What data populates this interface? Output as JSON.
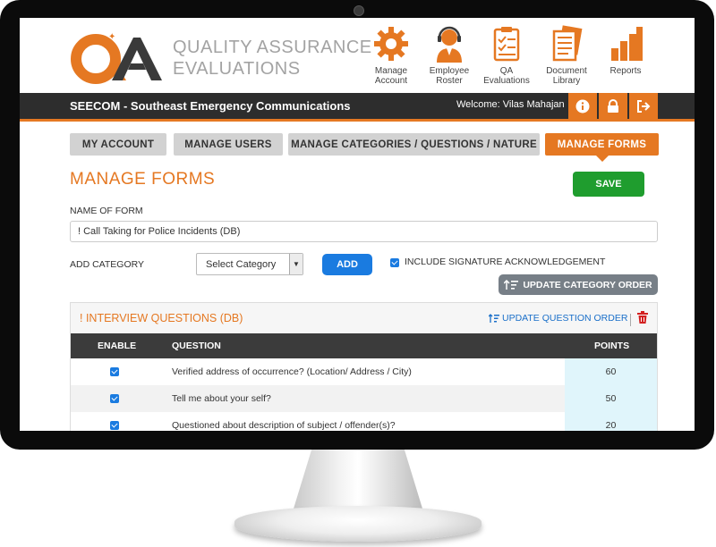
{
  "app": {
    "brand_line1": "QUALITY ASSURANCE",
    "brand_line2": "EVALUATIONS",
    "logo_text": "QA"
  },
  "nav": [
    {
      "label1": "Manage",
      "label2": "Account",
      "icon": "gear-icon"
    },
    {
      "label1": "Employee",
      "label2": "Roster",
      "icon": "headset-user-icon"
    },
    {
      "label1": "QA",
      "label2": "Evaluations",
      "icon": "clipboard-icon"
    },
    {
      "label1": "Document",
      "label2": "Library",
      "icon": "documents-icon"
    },
    {
      "label1": "Reports",
      "label2": "",
      "icon": "bar-chart-icon"
    }
  ],
  "bar": {
    "org": "SEECOM - Southeast Emergency Communications",
    "welcome": "Welcome: Vilas Mahajan"
  },
  "tabs": [
    {
      "label": "MY ACCOUNT"
    },
    {
      "label": "MANAGE USERS"
    },
    {
      "label": "MANAGE CATEGORIES / QUESTIONS / NATURE"
    },
    {
      "label": "MANAGE FORMS"
    }
  ],
  "form": {
    "title": "MANAGE FORMS",
    "save_label": "SAVE",
    "name_label": "NAME OF FORM",
    "name_value": "! Call Taking for Police Incidents (DB)",
    "add_category_label": "ADD CATEGORY",
    "select_value": "Select Category",
    "add_label": "ADD",
    "signature_label": "INCLUDE SIGNATURE ACKNOWLEDGEMENT",
    "update_category_label": "UPDATE CATEGORY ORDER"
  },
  "category": {
    "title": "! INTERVIEW QUESTIONS (DB)",
    "update_question_label": "UPDATE QUESTION ORDER",
    "headers": {
      "enable": "ENABLE",
      "question": "QUESTION",
      "points": "POINTS"
    },
    "rows": [
      {
        "question": "Verified address of occurrence? (Location/ Address / City)",
        "points": "60"
      },
      {
        "question": "Tell me about your self?",
        "points": "50"
      },
      {
        "question": "Questioned about description of subject / offender(s)?",
        "points": "20"
      }
    ]
  },
  "colors": {
    "accent": "#e57822",
    "save": "#1f9d2e",
    "primary": "#1a7be0",
    "dark": "#2d2d2d"
  }
}
